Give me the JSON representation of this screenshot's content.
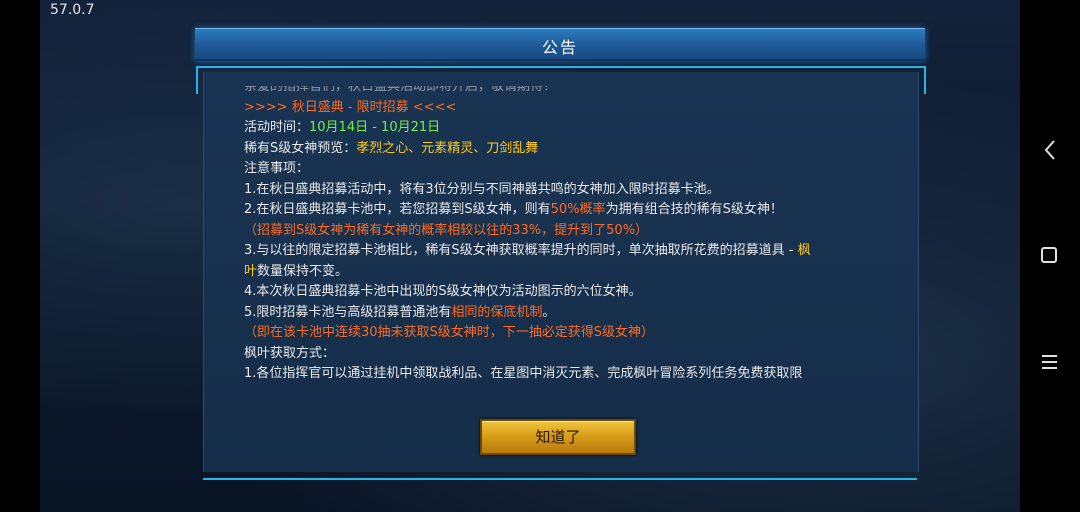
{
  "status": {
    "version": "57.0.7"
  },
  "dialog": {
    "title": "公告",
    "truncated_top_line": "亲爱的指挥官们，秋日盛典活动即将开启，敬请期待！",
    "lines": [
      {
        "parts": [
          {
            "text": ">>>>    秋日盛典 - 限时招募    <<<<",
            "color": "orange"
          }
        ]
      },
      {
        "parts": [
          {
            "text": "活动时间：",
            "color": "white"
          },
          {
            "text": "10月14日 - 10月21日",
            "color": "green"
          }
        ]
      },
      {
        "parts": [
          {
            "text": "稀有S级女神预览：",
            "color": "white"
          },
          {
            "text": "孝烈之心、元素精灵、刀剑乱舞",
            "color": "yellow"
          }
        ]
      },
      {
        "parts": [
          {
            "text": "注意事项：",
            "color": "white"
          }
        ]
      },
      {
        "parts": [
          {
            "text": "1.在秋日盛典招募活动中，将有3位分别与不同神器共鸣的女神加入限时招募卡池。",
            "color": "white"
          }
        ]
      },
      {
        "parts": [
          {
            "text": "2.在秋日盛典招募卡池中，若您招募到S级女神，则有",
            "color": "white"
          },
          {
            "text": "50%概率",
            "color": "orange"
          },
          {
            "text": "为拥有组合技的稀有S级女神！",
            "color": "white"
          }
        ]
      },
      {
        "parts": [
          {
            "text": "（招募到S级女神为稀有女神的概率相较以往的33%，提升到了50%）",
            "color": "orange"
          }
        ]
      },
      {
        "parts": [
          {
            "text": "3.与以往的限定招募卡池相比，稀有S级女神获取概率提升的同时，单次抽取所花费的招募道具 - ",
            "color": "white"
          },
          {
            "text": "枫",
            "color": "yellow"
          }
        ]
      },
      {
        "parts": [
          {
            "text": "叶",
            "color": "yellow"
          },
          {
            "text": "数量保持不变。",
            "color": "white"
          }
        ]
      },
      {
        "parts": [
          {
            "text": "4.本次秋日盛典招募卡池中出现的S级女神仅为活动图示的六位女神。",
            "color": "white"
          }
        ]
      },
      {
        "parts": [
          {
            "text": "5.限时招募卡池与高级招募普通池有",
            "color": "white"
          },
          {
            "text": "相同的保底机制",
            "color": "orange"
          },
          {
            "text": "。",
            "color": "white"
          }
        ]
      },
      {
        "parts": [
          {
            "text": "（即在该卡池中连续30抽未获取S级女神时，下一抽必定获得S级女神）",
            "color": "orange"
          }
        ]
      },
      {
        "parts": [
          {
            "text": "枫叶获取方式：",
            "color": "white"
          }
        ]
      },
      {
        "parts": [
          {
            "text": "1.各位指挥官可以通过挂机中领取战利品、在星图中消灭元素、完成枫叶冒险系列任务免费获取限",
            "color": "white"
          }
        ]
      }
    ],
    "ok_label": "知道了"
  },
  "nav": {
    "back_icon": "back-chevron-icon",
    "home_icon": "home-square-icon",
    "menu_icon": "menu-lines-icon"
  }
}
